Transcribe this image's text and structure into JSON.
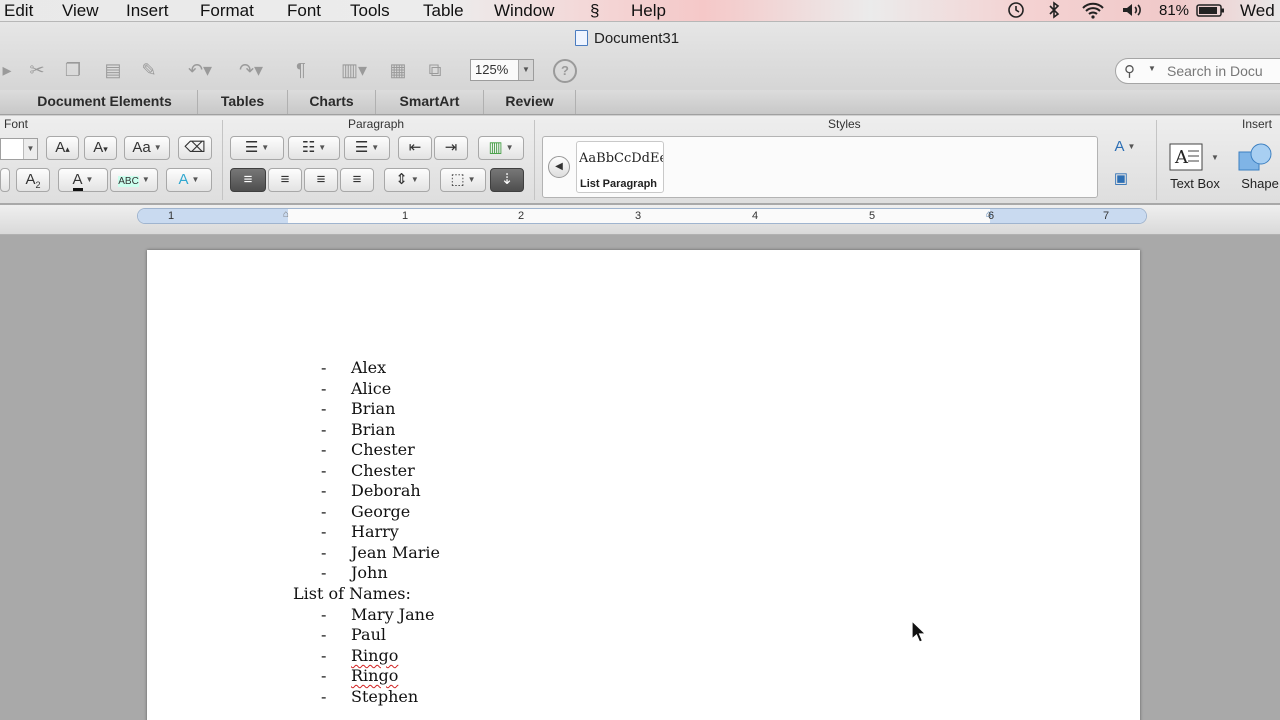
{
  "menubar": {
    "items": [
      "Edit",
      "View",
      "Insert",
      "Format",
      "Font",
      "Tools",
      "Table",
      "Window",
      "Help"
    ],
    "script_icon": "script-menu-icon",
    "battery": "81%",
    "clock": "Wed"
  },
  "window": {
    "title": "Document31",
    "zoom": "125%",
    "search_placeholder": "Search in Docu"
  },
  "ribbon_tabs": [
    "Document Elements",
    "Tables",
    "Charts",
    "SmartArt",
    "Review"
  ],
  "ribbon": {
    "font_label": "Font",
    "paragraph_label": "Paragraph",
    "styles_label": "Styles",
    "insert_label": "Insert",
    "style_sample": "AaBbCcDdEe",
    "style_name": "List Paragraph",
    "text_box_label": "Text Box",
    "shape_label": "Shape"
  },
  "ruler": {
    "numbers": [
      "1",
      "1",
      "2",
      "3",
      "4",
      "5",
      "6",
      "7"
    ]
  },
  "document": {
    "bullet": "-",
    "items_top": [
      "Alex",
      "Alice",
      "Brian",
      "Brian",
      "Chester",
      "Chester",
      "Deborah",
      "George",
      "Harry",
      "Jean Marie",
      "John"
    ],
    "heading": "List of Names:",
    "items_bottom": [
      "Mary Jane",
      "Paul",
      "Ringo",
      "Ringo",
      "Stephen"
    ],
    "misspelled": [
      "Ringo"
    ]
  },
  "colors": {
    "accent": "#c9daf0",
    "page": "#ffffff",
    "workspace": "#a9a9a9"
  }
}
